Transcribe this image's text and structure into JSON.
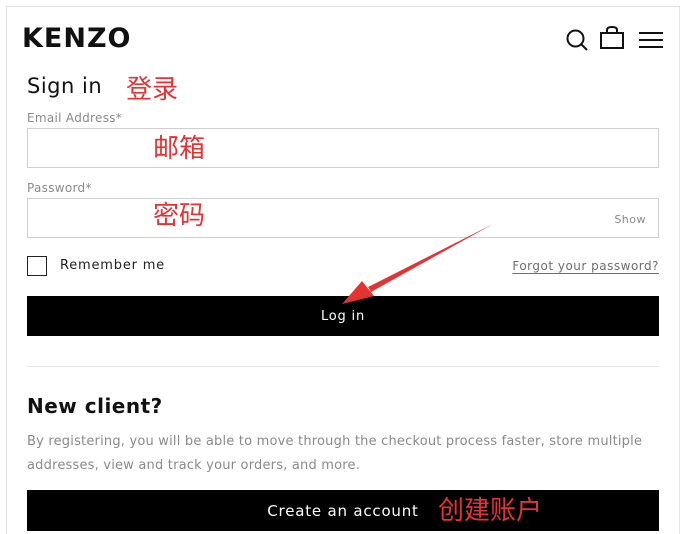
{
  "header": {
    "logo": "KENZO",
    "icons": [
      "search-icon",
      "shopping-bag-icon",
      "menu-icon"
    ]
  },
  "signin": {
    "title": "Sign in",
    "email": {
      "label": "Email Address*",
      "value": "",
      "placeholder": ""
    },
    "password": {
      "label": "Password*",
      "value": "",
      "placeholder": "",
      "show_label": "Show"
    },
    "remember_label": "Remember me",
    "forgot_label": "Forgot your password?",
    "login_button": "Log in"
  },
  "new_client": {
    "title": "New client?",
    "description": "By registering, you will be able to move through the checkout process faster, store multiple addresses, view and track your orders, and more.",
    "create_button": "Create an account"
  },
  "annotations": {
    "login": "登录",
    "email": "邮箱",
    "password": "密码",
    "create": "创建账户",
    "color": "#e53333"
  }
}
